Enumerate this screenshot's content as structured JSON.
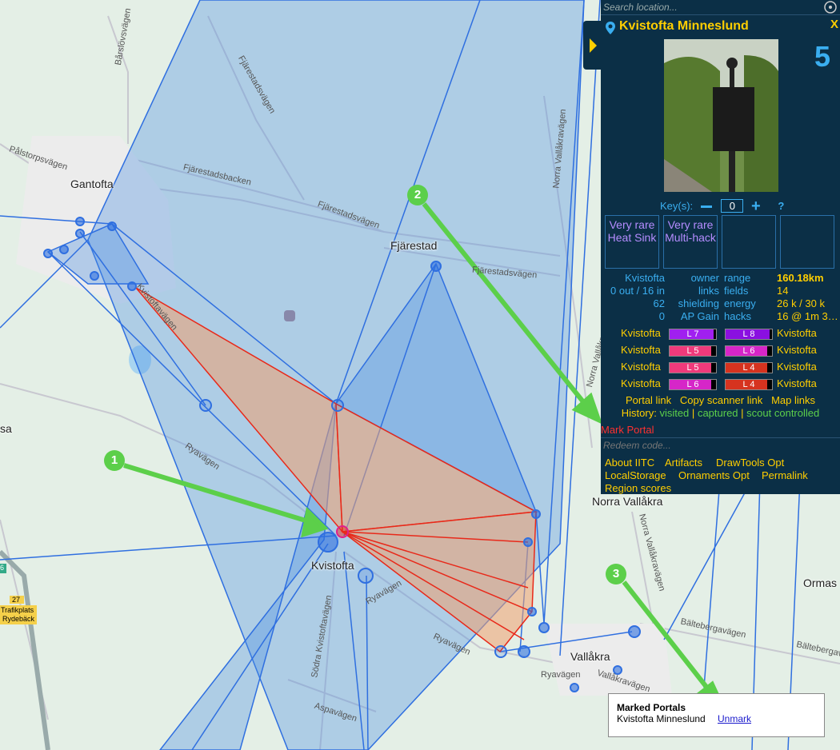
{
  "search": {
    "placeholder": "Search location..."
  },
  "portal": {
    "name": "Kvistofta Minneslund",
    "close": "X",
    "level": "5",
    "keys_label": "Key(s):",
    "keys_value": "0",
    "help": "?",
    "mods": [
      "Very rare Heat Sink",
      "Very rare Multi-hack",
      "",
      ""
    ],
    "stats": {
      "owner": "Kvistofta",
      "owner_label": "owner",
      "links": "0 out / 16 in",
      "links_label": "links",
      "shielding": "62",
      "shielding_label": "shielding",
      "ap": "0",
      "ap_label": "AP Gain",
      "range_label": "range",
      "range": "160.18km",
      "fields_label": "fields",
      "fields": "14",
      "energy_label": "energy",
      "energy": "26 k / 30 k",
      "hacks_label": "hacks",
      "hacks": "16 @ 1m 3…"
    },
    "resonators": [
      {
        "owner": "Kvistofta",
        "label": "L 7",
        "color": "#a020f0",
        "fill": 0.95
      },
      {
        "owner": "Kvistofta",
        "label": "L 8",
        "color": "#8a10e0",
        "fill": 0.95
      },
      {
        "owner": "Kvistofta",
        "label": "L 5",
        "color": "#ef3a7b",
        "fill": 0.9
      },
      {
        "owner": "Kvistofta",
        "label": "L 6",
        "color": "#d626c8",
        "fill": 0.9
      },
      {
        "owner": "Kvistofta",
        "label": "L 5",
        "color": "#ef3a7b",
        "fill": 0.9
      },
      {
        "owner": "Kvistofta",
        "label": "L 4",
        "color": "#d6331f",
        "fill": 0.9
      },
      {
        "owner": "Kvistofta",
        "label": "L 6",
        "color": "#d626c8",
        "fill": 0.9
      },
      {
        "owner": "Kvistofta",
        "label": "L 4",
        "color": "#d6331f",
        "fill": 0.9
      }
    ],
    "links_row": {
      "portal_link": "Portal link",
      "copy_scanner": "Copy scanner link",
      "map_links": "Map links"
    },
    "history": {
      "label": "History:",
      "visited": "visited",
      "sep1": "|",
      "captured": "captured",
      "sep2": "|",
      "scout": "scout controlled"
    },
    "mark_portal": "Mark Portal"
  },
  "redeem": {
    "placeholder": "Redeem code..."
  },
  "menu": {
    "about": "About IITC",
    "artifacts": "Artifacts",
    "drawtools": "DrawTools Opt",
    "localstorage": "LocalStorage",
    "ornaments": "Ornaments Opt",
    "permalink": "Permalink",
    "region": "Region scores"
  },
  "marked": {
    "title": "Marked Portals",
    "portal": "Kvistofta Minneslund",
    "unmark": "Unmark"
  },
  "map": {
    "towns": {
      "gantofta": "Gantofta",
      "fjarestad": "Fjärestad",
      "kvistofta": "Kvistofta",
      "vallakra": "Vallåkra",
      "norra_vallakra": "Norra Vallåkra",
      "ormas": "Ormas",
      "sa": "sa"
    },
    "roads": {
      "barslovsvagen": "Bårslövsvägen",
      "fjarestadsvagen1": "Fjärestadsvägen",
      "palstorpsvagen": "Pålstorpsvägen",
      "fjarestadsbacken": "Fjärestadsbacken",
      "fjarestadsvagen2": "Fjärestadsvägen",
      "fjarestadsvagen3": "Fjärestadsvägen",
      "norra_vallakravagen1": "Norra Vallåkravägen",
      "norra_vallakravagen2": "Norra Vallåkravägen",
      "norra_vallakravagen3": "Norra Vallåkravägen",
      "kvistoftavagen": "Kvistoftavägen",
      "ryavagen1": "Ryavägen",
      "ryavagen2": "Ryavägen",
      "ryavagen3": "Ryavägen",
      "sodra_kvistoftavagen": "Södra Kvistoftavägen",
      "aspavagen": "Aspavägen",
      "vallakravagen": "Vallåkravägen",
      "baltebergavagen1": "Bältebergavägen",
      "baltebergavagen2": "Bältebergav",
      "trafikplats": "Trafikplats",
      "rydeback": "Rydebäck",
      "road27": "27",
      "road6": "6"
    },
    "annotations": [
      "1",
      "2",
      "3"
    ]
  },
  "colors": {
    "sidebar": "#0b2f46",
    "accent": "#ffce00",
    "field_blue": "#4a90e2",
    "field_red": "#e07a4a",
    "arrow": "#5ccf4a"
  }
}
